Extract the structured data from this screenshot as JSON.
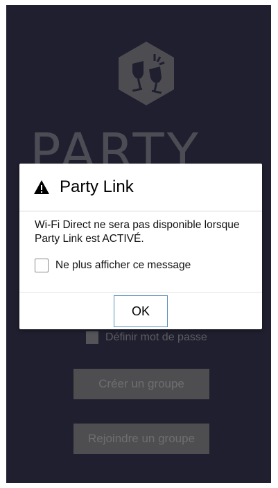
{
  "app": {
    "title_text": "PARTY",
    "logo_icon": "party-glasses-icon"
  },
  "background": {
    "password_option": {
      "label": "Définir mot de passe",
      "checked": false
    },
    "create_group_button": "Créer un groupe",
    "join_group_button": "Rejoindre un groupe"
  },
  "dialog": {
    "icon": "warning-icon",
    "title": "Party Link",
    "message": "Wi-Fi Direct ne sera pas disponible lorsque Party Link est ACTIVÉ.",
    "dont_show_checkbox": {
      "label": "Ne plus afficher ce message",
      "checked": false
    },
    "ok_button": "OK"
  },
  "colors": {
    "screen_background": "#393957",
    "dialog_background": "#ffffff",
    "ok_button_border": "#5b8fbf"
  }
}
